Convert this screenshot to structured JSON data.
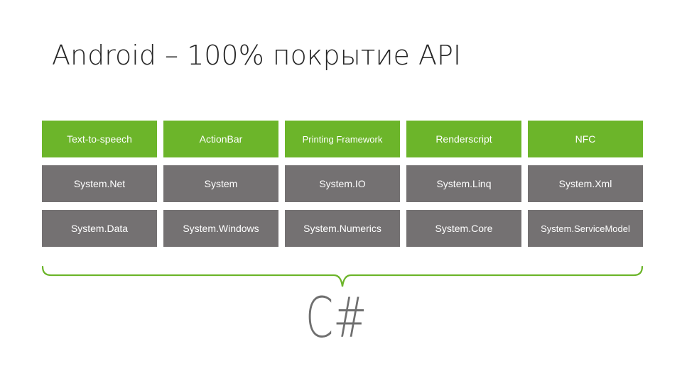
{
  "slide": {
    "title": "Android – 100% покрытие API",
    "accent_color": "#6cb52a",
    "neutral_color": "#747172",
    "rows": [
      {
        "kind": "android",
        "items": [
          "Text-to-speech",
          "ActionBar",
          "Printing Framework",
          "Renderscript",
          "NFC"
        ]
      },
      {
        "kind": "dotnet",
        "items": [
          "System.Net",
          "System",
          "System.IO",
          "System.Linq",
          "System.Xml"
        ]
      },
      {
        "kind": "dotnet",
        "items": [
          "System.Data",
          "System.Windows",
          "System.Numerics",
          "System.Core",
          "System.ServiceModel"
        ]
      }
    ],
    "brace_icon": "curly-brace-underline",
    "footer_label": "C#"
  }
}
